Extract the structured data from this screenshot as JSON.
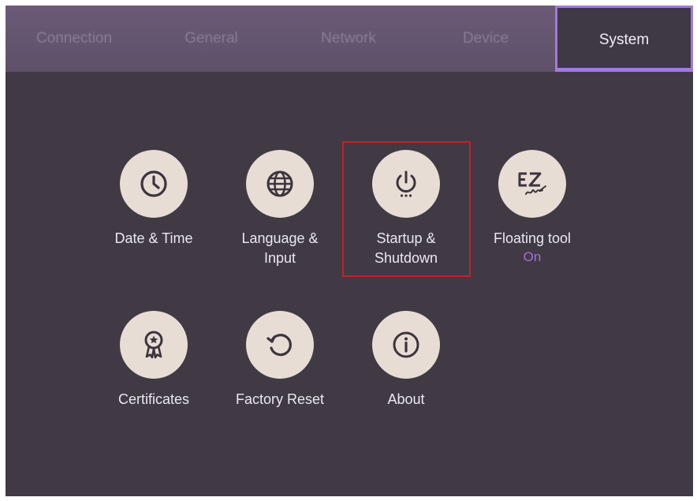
{
  "tabs": [
    {
      "label": "Connection",
      "active": false
    },
    {
      "label": "General",
      "active": false
    },
    {
      "label": "Network",
      "active": false
    },
    {
      "label": "Device",
      "active": false
    },
    {
      "label": "System",
      "active": true
    }
  ],
  "items": [
    {
      "label": "Date & Time",
      "icon": "clock-icon"
    },
    {
      "label": "Language &\nInput",
      "icon": "globe-icon"
    },
    {
      "label": "Startup &\nShutdown",
      "icon": "power-icon",
      "highlighted": true
    },
    {
      "label": "Floating tool",
      "icon": "ez-write-icon",
      "status": "On"
    },
    {
      "label": "Certificates",
      "icon": "certificate-ribbon-icon"
    },
    {
      "label": "Factory Reset",
      "icon": "reset-icon"
    },
    {
      "label": "About",
      "icon": "info-icon"
    }
  ],
  "colors": {
    "tab_active_border": "#a27ad9",
    "status_on": "#a36ee0",
    "highlight_box": "#c4202a",
    "icon_bg": "#e7ddd4",
    "background": "#413a45"
  }
}
